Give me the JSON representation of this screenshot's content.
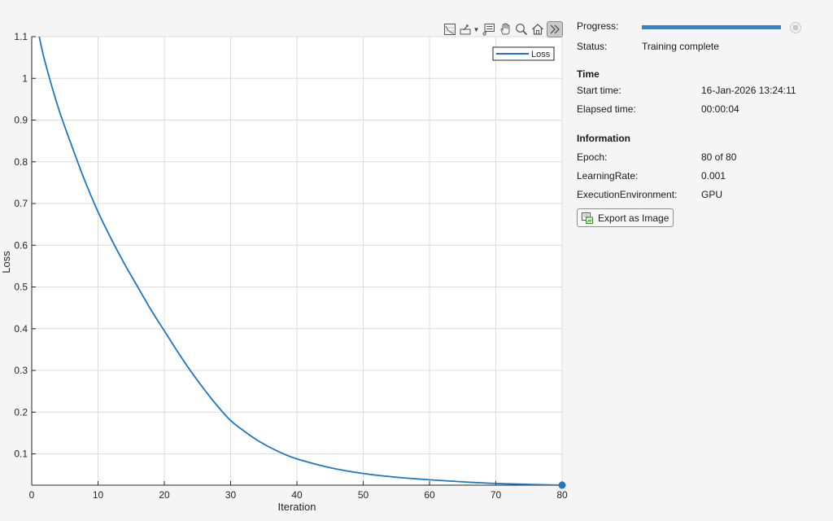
{
  "toolbar": {
    "icons": [
      "data-tips-icon",
      "export-icon",
      "chevron-down-icon",
      "datatip-icon",
      "pan-icon",
      "zoom-icon",
      "home-icon",
      "collapse-panel-icon"
    ]
  },
  "panel": {
    "progress_label": "Progress:",
    "progress_fraction": 1.0,
    "status_label": "Status:",
    "status_value": "Training complete",
    "time_title": "Time",
    "start_label": "Start time:",
    "start_value": "16-Jan-2026 13:24:11",
    "elapsed_label": "Elapsed time:",
    "elapsed_value": "00:00:04",
    "info_title": "Information",
    "epoch_label": "Epoch:",
    "epoch_value": "80 of 80",
    "lr_label": "LearningRate:",
    "lr_value": "0.001",
    "env_label": "ExecutionEnvironment:",
    "env_value": "GPU",
    "export_label": "Export as Image"
  },
  "colors": {
    "series": "#1f77c4",
    "accent": "#2f84d6",
    "grid": "#dcdcdc"
  },
  "chart_data": {
    "type": "line",
    "xlabel": "Iteration",
    "ylabel": "Loss",
    "xlim": [
      0,
      80
    ],
    "ylim": [
      0.025,
      1.1
    ],
    "xticks": [
      0,
      10,
      20,
      30,
      40,
      50,
      60,
      70,
      80
    ],
    "yticks": [
      0.1,
      0.2,
      0.3,
      0.4,
      0.5,
      0.6,
      0.7,
      0.8,
      0.9,
      1,
      1.1
    ],
    "grid": true,
    "legend_position": "top-right",
    "series": [
      {
        "name": "Loss",
        "x": [
          1,
          2,
          4,
          6,
          8,
          10,
          12,
          14,
          16,
          18,
          20,
          22,
          24,
          26,
          28,
          30,
          32,
          34,
          36,
          38,
          40,
          45,
          50,
          55,
          60,
          65,
          70,
          75,
          80
        ],
        "y": [
          1.11,
          1.04,
          0.93,
          0.84,
          0.755,
          0.68,
          0.615,
          0.555,
          0.5,
          0.445,
          0.395,
          0.345,
          0.298,
          0.255,
          0.215,
          0.18,
          0.155,
          0.133,
          0.115,
          0.1,
          0.088,
          0.067,
          0.053,
          0.044,
          0.038,
          0.033,
          0.029,
          0.027,
          0.025
        ]
      }
    ],
    "last_point": {
      "x": 80,
      "y": 0.025
    }
  }
}
